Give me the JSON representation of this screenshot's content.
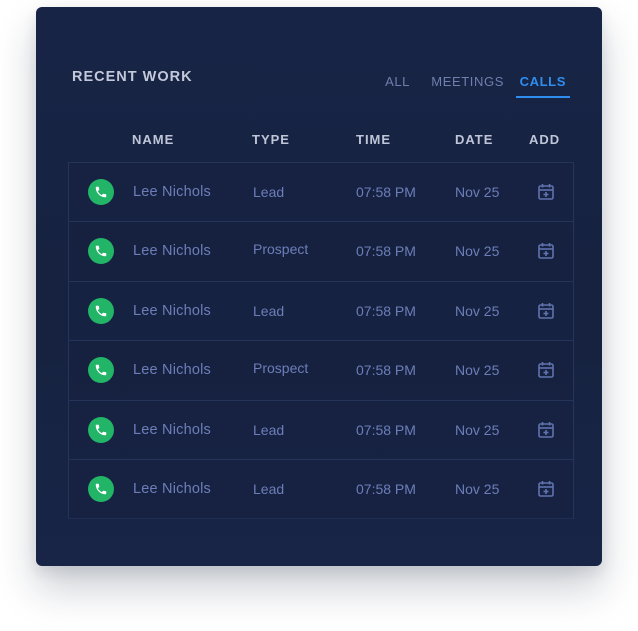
{
  "card": {
    "title": "RECENT WORK",
    "filter_tabs": [
      {
        "label": "ALL",
        "active": false
      },
      {
        "label": "MEETINGS",
        "active": false
      },
      {
        "label": "CALLS",
        "active": true
      }
    ]
  },
  "table": {
    "columns": [
      "NAME",
      "TYPE",
      "TIME",
      "DATE",
      "ADD"
    ],
    "rows": [
      {
        "icon": "phone-icon",
        "name": "Lee Nichols",
        "type": "Lead",
        "time": "07:58 PM",
        "date": "Nov 25",
        "add_icon": "calendar-add-icon"
      },
      {
        "icon": "phone-icon",
        "name": "Lee Nichols",
        "type": "Prospect",
        "time": "07:58 PM",
        "date": "Nov 25",
        "add_icon": "calendar-add-icon"
      },
      {
        "icon": "phone-icon",
        "name": "Lee Nichols",
        "type": "Lead",
        "time": "07:58 PM",
        "date": "Nov 25",
        "add_icon": "calendar-add-icon"
      },
      {
        "icon": "phone-icon",
        "name": "Lee Nichols",
        "type": "Prospect",
        "time": "07:58 PM",
        "date": "Nov 25",
        "add_icon": "calendar-add-icon"
      },
      {
        "icon": "phone-icon",
        "name": "Lee Nichols",
        "type": "Lead",
        "time": "07:58 PM",
        "date": "Nov 25",
        "add_icon": "calendar-add-icon"
      },
      {
        "icon": "phone-icon",
        "name": "Lee Nichols",
        "type": "Lead",
        "time": "07:58 PM",
        "date": "Nov 25",
        "add_icon": "calendar-add-icon"
      }
    ]
  },
  "colors": {
    "card_background": "#172342",
    "accent": "#2f8df0",
    "call_green": "#22b467",
    "muted_text": "#6c7eb8",
    "heading_text": "#c0c6d8"
  }
}
